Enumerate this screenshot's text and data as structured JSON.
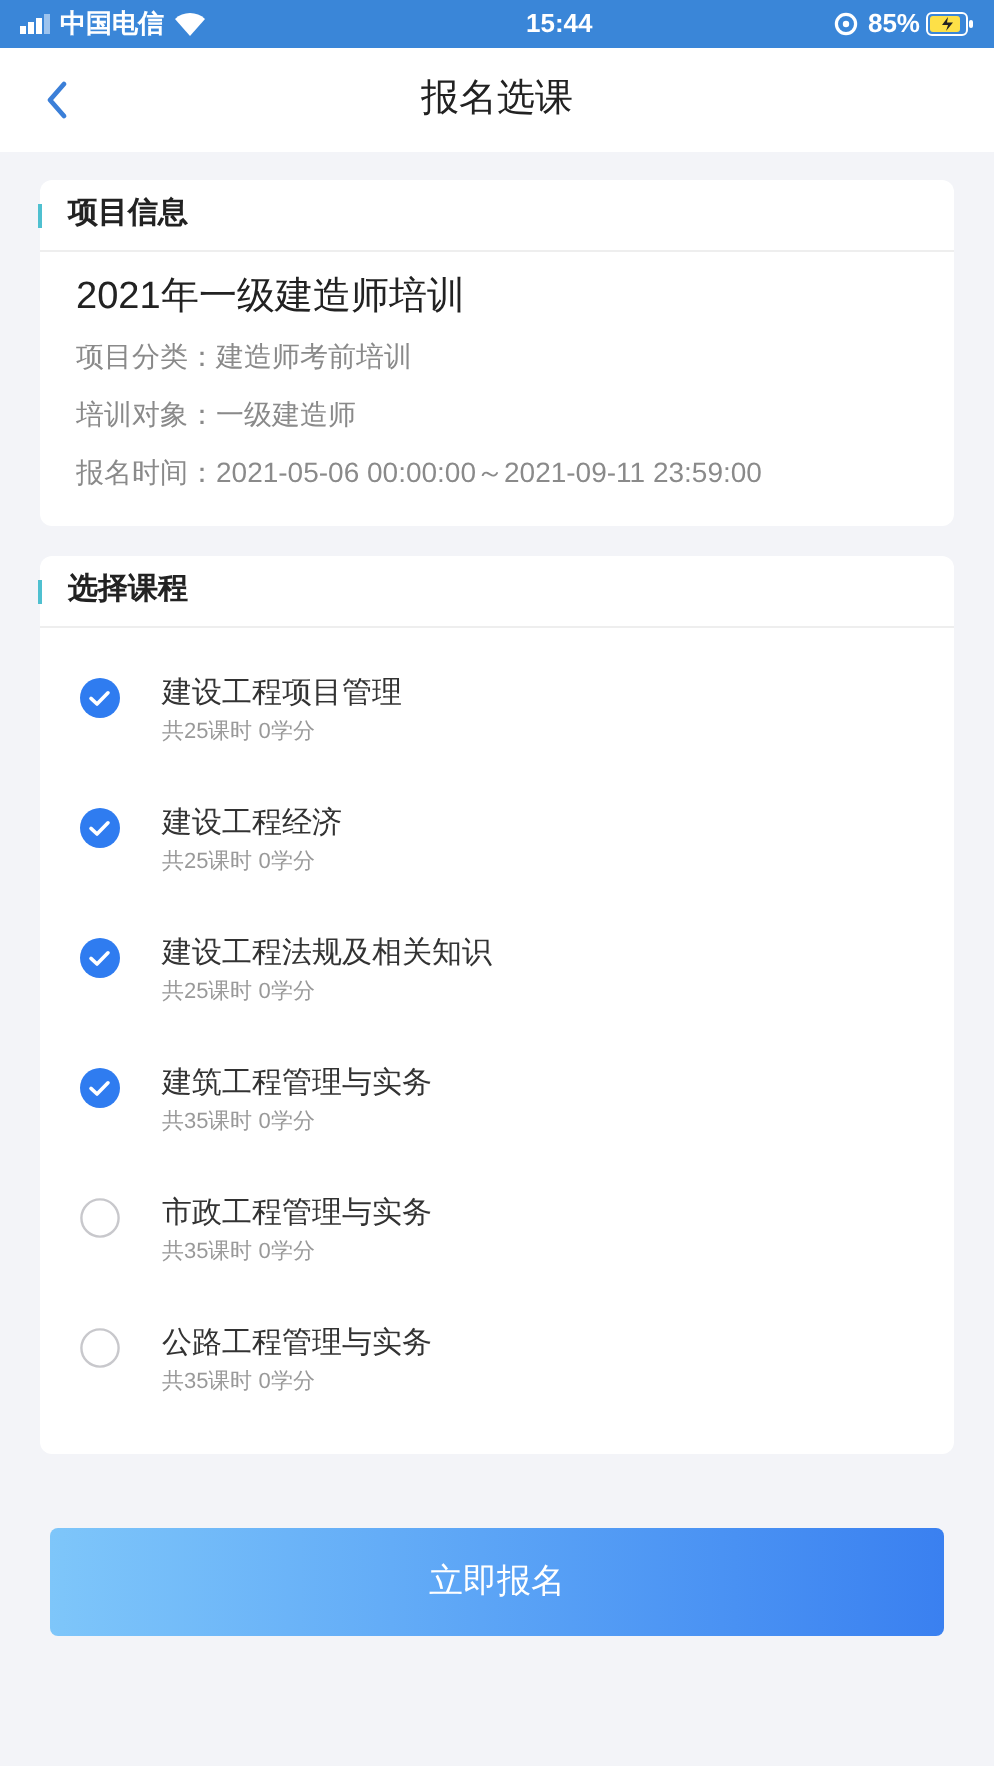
{
  "status_bar": {
    "carrier": "中国电信",
    "time": "15:44",
    "battery": "85%"
  },
  "nav": {
    "title": "报名选课"
  },
  "project": {
    "heading": "项目信息",
    "name": "2021年一级建造师培训",
    "details": [
      "项目分类：建造师考前培训",
      "培训对象：一级建造师",
      "报名时间：2021-05-06 00:00:00～2021-09-11 23:59:00"
    ]
  },
  "courses": {
    "heading": "选择课程",
    "items": [
      {
        "name": "建设工程项目管理",
        "meta": "共25课时 0学分",
        "checked": true
      },
      {
        "name": "建设工程经济",
        "meta": "共25课时 0学分",
        "checked": true
      },
      {
        "name": "建设工程法规及相关知识",
        "meta": "共25课时 0学分",
        "checked": true
      },
      {
        "name": "建筑工程管理与实务",
        "meta": "共35课时 0学分",
        "checked": true
      },
      {
        "name": "市政工程管理与实务",
        "meta": "共35课时 0学分",
        "checked": false
      },
      {
        "name": "公路工程管理与实务",
        "meta": "共35课时 0学分",
        "checked": false
      }
    ]
  },
  "submit": "立即报名"
}
